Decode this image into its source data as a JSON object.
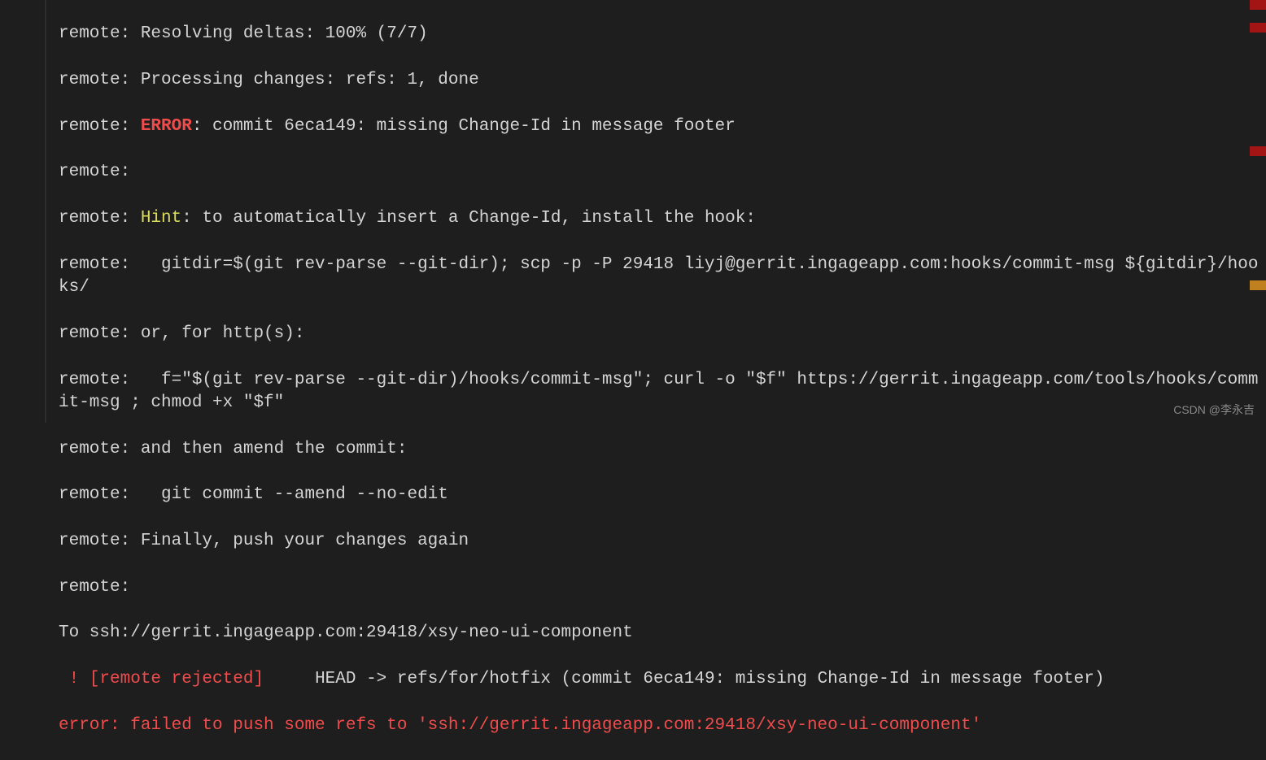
{
  "terminal": {
    "line1": "remote: Resolving deltas: 100% (7/7)",
    "line2": "remote: Processing changes: refs: 1, done",
    "line3_prefix": "remote: ",
    "line3_error": "ERROR",
    "line3_rest": ": commit 6eca149: missing Change-Id in message footer",
    "line4": "remote:",
    "line5_prefix": "remote: ",
    "line5_hint": "Hint",
    "line5_rest": ": to automatically insert a Change-Id, install the hook:",
    "line6": "remote:   gitdir=$(git rev-parse --git-dir); scp -p -P 29418 liyj@gerrit.ingageapp.com:hooks/commit-msg ${gitdir}/hooks/",
    "line7": "remote: or, for http(s):",
    "line8": "remote:   f=\"$(git rev-parse --git-dir)/hooks/commit-msg\"; curl -o \"$f\" https://gerrit.ingageapp.com/tools/hooks/commit-msg ; chmod +x \"$f\"",
    "line9": "remote: and then amend the commit:",
    "line10": "remote:   git commit --amend --no-edit",
    "line11": "remote: Finally, push your changes again",
    "line12": "remote:",
    "line13": "To ssh://gerrit.ingageapp.com:29418/xsy-neo-ui-component",
    "line14_bang": " ! [remote rejected]",
    "line14_rest": "     HEAD -> refs/for/hotfix (commit 6eca149: missing Change-Id in message footer)",
    "line15": "error: failed to push some refs to 'ssh://gerrit.ingageapp.com:29418/xsy-neo-ui-component'"
  },
  "watermark": "CSDN @李永吉",
  "indicators": {
    "i1_top": "0",
    "i2_top": "28",
    "i3_top": "180",
    "i4_top": "345"
  }
}
